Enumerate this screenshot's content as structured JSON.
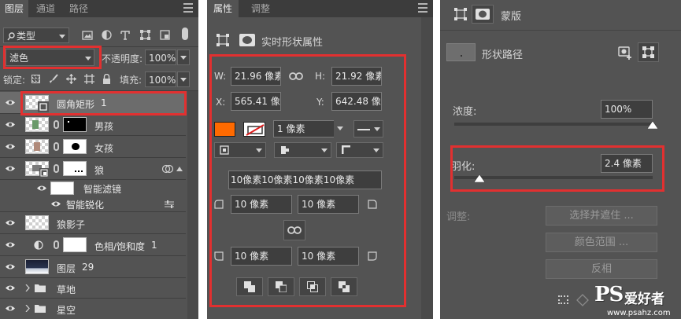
{
  "layers_panel": {
    "tabs": [
      "图层",
      "通道",
      "路径"
    ],
    "filter_label": "类型",
    "blend_mode": "滤色",
    "opacity_label": "不透明度:",
    "opacity_value": "100%",
    "lock_label": "锁定:",
    "fill_label": "填充:",
    "fill_value": "100%",
    "layers": [
      {
        "name": "圆角矩形",
        "suffix": "1"
      },
      {
        "name": "男孩"
      },
      {
        "name": "女孩"
      },
      {
        "name": "狼"
      },
      {
        "name": "智能滤镜"
      },
      {
        "name": "智能锐化"
      },
      {
        "name": "狼影子"
      },
      {
        "name": "色相/饱和度",
        "suffix": "1"
      },
      {
        "name": "图层",
        "suffix": "29"
      },
      {
        "name": "草地"
      },
      {
        "name": "星空"
      }
    ]
  },
  "properties_panel": {
    "tabs": [
      "属性",
      "调整"
    ],
    "header": "实时形状属性",
    "w_label": "W:",
    "w_value": "21.96 像素",
    "h_label": "H:",
    "h_value": "21.92 像素",
    "x_label": "X:",
    "x_value": "565.41 像",
    "y_label": "Y:",
    "y_value": "642.48 像",
    "fill_color": "#ff6a00",
    "stroke_width": "1 像素",
    "corners_combined": "10像素10像素10像素10像素",
    "corner_tl": "10 像素",
    "corner_tr": "10 像素",
    "corner_bl": "10 像素",
    "corner_br": "10 像素"
  },
  "mask_panel": {
    "title": "蒙版",
    "shape_path_label": "形状路径",
    "density_label": "浓度:",
    "density_value": "100%",
    "density_level": 1.0,
    "feather_label": "羽化:",
    "feather_value": "2.4 像素",
    "adjust_label": "调整:",
    "select_mask_btn": "选择并遮住 ...",
    "color_range_btn": "颜色范围 ...",
    "invert_btn": "反相"
  },
  "watermark": {
    "logo": "PS",
    "text": "爱好者",
    "url": "www.psahz.com"
  },
  "colors": {
    "highlight_red": "#e23030",
    "panel_bg": "#535353",
    "tab_bar_bg": "#3c3c3c"
  }
}
